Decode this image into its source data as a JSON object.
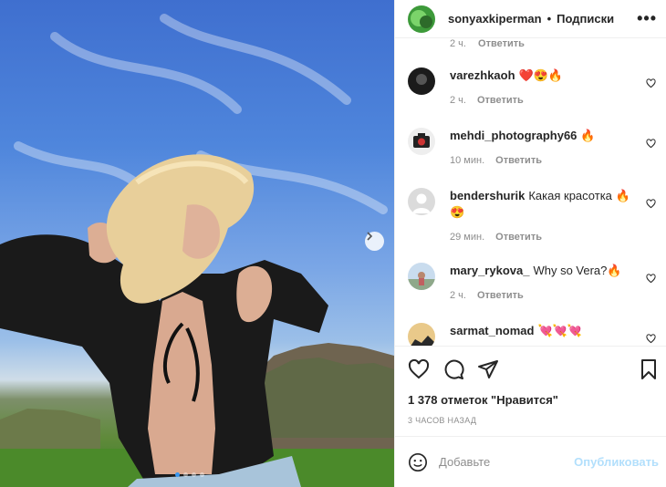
{
  "post": {
    "author": "sonyaxkiperman",
    "separator": "•",
    "follow_status": "Подписки",
    "more_icon": "more-horizontal-icon",
    "carousel": {
      "dots": 4,
      "active_index": 0
    }
  },
  "comments": {
    "partial_top": {
      "time": "2 ч.",
      "reply_label": "Ответить"
    },
    "items": [
      {
        "username": "varezhkaoh",
        "text": "❤️😍🔥",
        "time": "2 ч.",
        "reply_label": "Ответить"
      },
      {
        "username": "mehdi_photography66",
        "text": "🔥",
        "time": "10 мин.",
        "reply_label": "Ответить"
      },
      {
        "username": "bendershurik",
        "text": "Какая красотка 🔥 😍",
        "time": "29 мин.",
        "reply_label": "Ответить"
      },
      {
        "username": "mary_rykova_",
        "text": "Why so Vera?🔥",
        "time": "2 ч.",
        "reply_label": "Ответить"
      },
      {
        "username": "sarmat_nomad",
        "text": "💘💘💘",
        "time": "",
        "reply_label": ""
      }
    ]
  },
  "actions": {
    "like_icon": "heart-icon",
    "comment_icon": "comment-bubble-icon",
    "share_icon": "paper-plane-icon",
    "save_icon": "bookmark-icon"
  },
  "likes_text": "1 378 отметок \"Нравится\"",
  "timestamp": "3 ЧАСОВ НАЗАД",
  "add_comment": {
    "placeholder": "Добавьте",
    "publish_label": "Опубликовать",
    "emoji_icon": "smiley-icon"
  },
  "colors": {
    "publish_disabled": "#b2dffc",
    "meta_gray": "#8e8e8e",
    "text": "#262626",
    "carousel_active_dot": "#3897f0"
  }
}
